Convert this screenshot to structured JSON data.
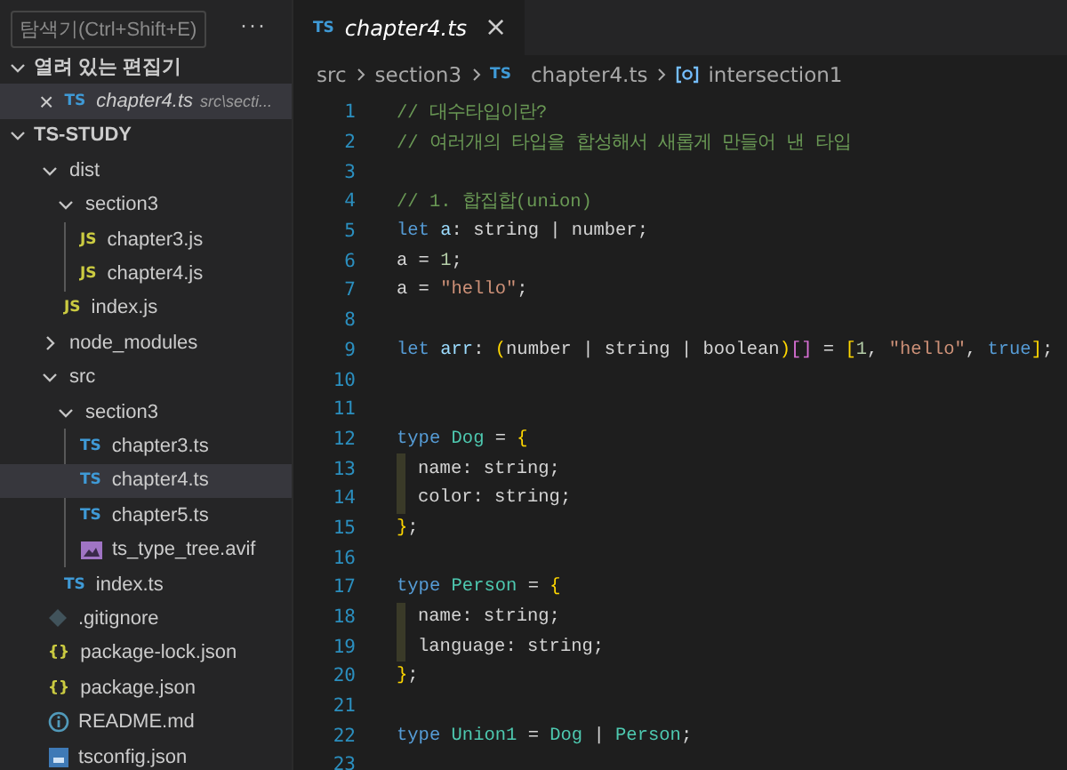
{
  "sidebar": {
    "tooltip": "탐색기(Ctrl+Shift+E)",
    "more_button": "···",
    "open_editors": {
      "title": "열려 있는 편집기",
      "expanded": true,
      "items": [
        {
          "close": "×",
          "badge": "TS",
          "kind": "ts",
          "name": "chapter4.ts",
          "path": "src\\secti...",
          "selected": true
        }
      ]
    },
    "project": {
      "title": "TS-STUDY",
      "expanded": true,
      "items": [
        {
          "kind": "folder",
          "name": "dist",
          "expanded": true,
          "selected": false,
          "children": [
            {
              "kind": "folder",
              "name": "section3",
              "expanded": true,
              "selected": false,
              "children": [
                {
                  "kind": "js",
                  "badge": "JS",
                  "name": "chapter3.js",
                  "selected": false
                },
                {
                  "kind": "js",
                  "badge": "JS",
                  "name": "chapter4.js",
                  "selected": false
                }
              ]
            },
            {
              "kind": "js",
              "badge": "JS",
              "name": "index.js",
              "selected": false
            }
          ]
        },
        {
          "kind": "folder",
          "name": "node_modules",
          "expanded": false,
          "selected": false
        },
        {
          "kind": "folder",
          "name": "src",
          "expanded": true,
          "selected": false,
          "children": [
            {
              "kind": "folder",
              "name": "section3",
              "expanded": true,
              "selected": false,
              "children": [
                {
                  "kind": "ts",
                  "badge": "TS",
                  "name": "chapter3.ts",
                  "selected": false
                },
                {
                  "kind": "ts",
                  "badge": "TS",
                  "name": "chapter4.ts",
                  "selected": true
                },
                {
                  "kind": "ts",
                  "badge": "TS",
                  "name": "chapter5.ts",
                  "selected": false
                },
                {
                  "kind": "image",
                  "name": "ts_type_tree.avif",
                  "selected": false
                }
              ]
            },
            {
              "kind": "ts",
              "badge": "TS",
              "name": "index.ts",
              "selected": false
            }
          ]
        },
        {
          "kind": "git",
          "name": ".gitignore",
          "selected": false
        },
        {
          "kind": "json",
          "badge": "{}",
          "name": "package-lock.json",
          "selected": false
        },
        {
          "kind": "json",
          "badge": "{}",
          "name": "package.json",
          "selected": false
        },
        {
          "kind": "info",
          "name": "README.md",
          "selected": false
        },
        {
          "kind": "tsconfig",
          "name": "tsconfig.json",
          "selected": false
        }
      ]
    }
  },
  "editor": {
    "tabs": [
      {
        "badge": "TS",
        "label": "chapter4.ts",
        "close": "×",
        "selected": true
      }
    ],
    "breadcrumb": [
      {
        "text": "src",
        "kind": "folder"
      },
      {
        "text": "section3",
        "kind": "folder"
      },
      {
        "text": "chapter4.ts",
        "kind": "file",
        "badge": "TS"
      },
      {
        "text": "intersection1",
        "kind": "symbol"
      }
    ],
    "lines": [
      {
        "number": "1",
        "tokens": [
          {
            "t": "// 대수타입이란?",
            "kind": "comment"
          }
        ]
      },
      {
        "number": "2",
        "tokens": [
          {
            "t": "// 여러개의 타입을 합성해서 새롭게 만들어 낸 타입",
            "kind": "comment"
          }
        ]
      },
      {
        "number": "3"
      },
      {
        "number": "4",
        "tokens": [
          {
            "t": "// 1. 합집합(union)",
            "kind": "comment"
          }
        ]
      },
      {
        "number": "5",
        "tokens": [
          {
            "t": "let ",
            "kind": "keyword"
          },
          {
            "t": "a",
            "kind": "var"
          },
          {
            "t": ": string | number;",
            "kind": "plain"
          }
        ]
      },
      {
        "number": "6",
        "tokens": [
          {
            "t": "a = ",
            "kind": "plain"
          },
          {
            "t": "1",
            "kind": "number"
          },
          {
            "t": ";",
            "kind": "plain"
          }
        ]
      },
      {
        "number": "7",
        "tokens": [
          {
            "t": "a = ",
            "kind": "plain"
          },
          {
            "t": "\"hello\"",
            "kind": "string"
          },
          {
            "t": ";",
            "kind": "plain"
          }
        ]
      },
      {
        "number": "8"
      },
      {
        "number": "9",
        "tokens": [
          {
            "t": "let ",
            "kind": "keyword"
          },
          {
            "t": "arr",
            "kind": "var"
          },
          {
            "t": ": ",
            "kind": "plain"
          },
          {
            "t": "(",
            "kind": "bracket1"
          },
          {
            "t": "number | string | boolean",
            "kind": "plain"
          },
          {
            "t": ")",
            "kind": "bracket1"
          },
          {
            "t": "[]",
            "kind": "bracket2"
          },
          {
            "t": " = ",
            "kind": "plain"
          },
          {
            "t": "[",
            "kind": "bracket1"
          },
          {
            "t": "1",
            "kind": "number"
          },
          {
            "t": ", ",
            "kind": "plain"
          },
          {
            "t": "\"hello\"",
            "kind": "string"
          },
          {
            "t": ", ",
            "kind": "plain"
          },
          {
            "t": "true",
            "kind": "keyword"
          },
          {
            "t": "]",
            "kind": "bracket1"
          },
          {
            "t": ";",
            "kind": "plain"
          }
        ]
      },
      {
        "number": "10"
      },
      {
        "number": "11"
      },
      {
        "number": "12",
        "tokens": [
          {
            "t": "type ",
            "kind": "keyword"
          },
          {
            "t": "Dog",
            "kind": "type"
          },
          {
            "t": " = ",
            "kind": "plain"
          },
          {
            "t": "{",
            "kind": "bracket1"
          }
        ]
      },
      {
        "number": "13",
        "guide": true,
        "tokens": [
          {
            "t": "name: string;",
            "kind": "plain"
          }
        ]
      },
      {
        "number": "14",
        "guide": true,
        "tokens": [
          {
            "t": "color: string;",
            "kind": "plain"
          }
        ]
      },
      {
        "number": "15",
        "tokens": [
          {
            "t": "}",
            "kind": "bracket1"
          },
          {
            "t": ";",
            "kind": "plain"
          }
        ]
      },
      {
        "number": "16"
      },
      {
        "number": "17",
        "tokens": [
          {
            "t": "type ",
            "kind": "keyword"
          },
          {
            "t": "Person",
            "kind": "type"
          },
          {
            "t": " = ",
            "kind": "plain"
          },
          {
            "t": "{",
            "kind": "bracket1"
          }
        ]
      },
      {
        "number": "18",
        "guide": true,
        "tokens": [
          {
            "t": "name: string;",
            "kind": "plain"
          }
        ]
      },
      {
        "number": "19",
        "guide": true,
        "tokens": [
          {
            "t": "language: string;",
            "kind": "plain"
          }
        ]
      },
      {
        "number": "20",
        "tokens": [
          {
            "t": "}",
            "kind": "bracket1"
          },
          {
            "t": ";",
            "kind": "plain"
          }
        ]
      },
      {
        "number": "21"
      },
      {
        "number": "22",
        "tokens": [
          {
            "t": "type ",
            "kind": "keyword"
          },
          {
            "t": "Union1",
            "kind": "type"
          },
          {
            "t": " = ",
            "kind": "plain"
          },
          {
            "t": "Dog",
            "kind": "type"
          },
          {
            "t": " | ",
            "kind": "plain"
          },
          {
            "t": "Person",
            "kind": "type"
          },
          {
            "t": ";",
            "kind": "plain"
          }
        ]
      },
      {
        "number": "23"
      }
    ]
  }
}
